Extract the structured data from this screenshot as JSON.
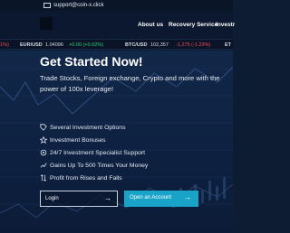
{
  "topbar": {
    "email": "support@coin-x.click",
    "email_icon": "envelope-icon"
  },
  "nav": {
    "items": [
      "About us",
      "Recovery Service",
      "Investr"
    ]
  },
  "ticker": [
    {
      "pair": "",
      "price": "",
      "change": "1%)",
      "dir": "neg"
    },
    {
      "pair": "EUR/USD",
      "price": "1.04096",
      "change": "+0.00 (+0.02%)",
      "dir": "pos"
    },
    {
      "pair": "BTC/USD",
      "price": "102,357",
      "change": "-1,275 (-1.23%)",
      "dir": "neg"
    },
    {
      "pair": "ET",
      "price": "",
      "change": "",
      "dir": "dim"
    }
  ],
  "hero": {
    "headline": "Get Started Now!",
    "sub_line1": "Trade Stocks, Foreign exchange, Crypto and more with the",
    "sub_line2": "power of 100x leverage!",
    "features": [
      {
        "icon": "tag-icon",
        "text": "Several Investment Options"
      },
      {
        "icon": "star-icon",
        "text": "Investment Bonuses"
      },
      {
        "icon": "headset-icon",
        "text": "24/7 Investment Specialist Support"
      },
      {
        "icon": "chart-icon",
        "text": "Gains Up To 500 Times Your Money"
      },
      {
        "icon": "arrows-updown-icon",
        "text": "Profit from Rises and Falls"
      }
    ],
    "login_label": "Login",
    "open_account_label": "Open an Account",
    "arrow_glyph": "→"
  },
  "colors": {
    "background": "#0d1b33",
    "accent": "#1aa3c8",
    "positive": "#2fd67a",
    "negative": "#ff4a5a"
  }
}
